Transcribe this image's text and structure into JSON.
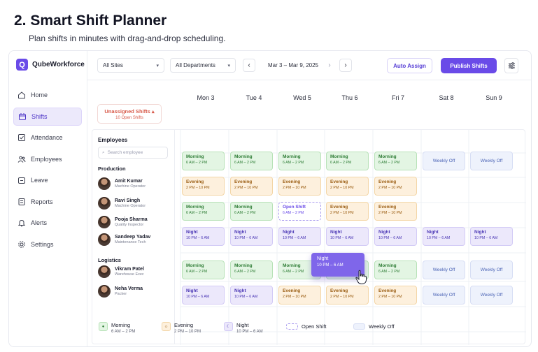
{
  "header": {
    "title": "2. Smart Shift Planner",
    "subtitle": "Plan shifts in minutes with drag-and-drop scheduling."
  },
  "app": {
    "brand": "QubeWorkforce",
    "nav": [
      {
        "label": "Home",
        "icon": "home-icon",
        "active": false
      },
      {
        "label": "Shifts",
        "icon": "calendar-icon",
        "active": true
      },
      {
        "label": "Attendance",
        "icon": "check-square-icon",
        "active": false
      },
      {
        "label": "Employees",
        "icon": "users-icon",
        "active": false
      },
      {
        "label": "Leave",
        "icon": "leave-icon",
        "active": false
      },
      {
        "label": "Reports",
        "icon": "report-icon",
        "active": false
      },
      {
        "label": "Alerts",
        "icon": "bell-icon",
        "active": false
      },
      {
        "label": "Settings",
        "icon": "gear-icon",
        "active": false
      }
    ]
  },
  "toolbar": {
    "site": "All Sites",
    "department": "All Departments",
    "date_range": "Mar 3 – Mar 9, 2025",
    "auto_assign": "Auto Assign",
    "publish": "Publish Shifts"
  },
  "days": [
    "Mon 3",
    "Tue 4",
    "Wed 5",
    "Thu 6",
    "Fri 7",
    "Sat 8",
    "Sun 9"
  ],
  "unassigned": {
    "label": "Unassigned Shifts",
    "count": "10 Open Shifts"
  },
  "employees_panel": {
    "title": "Employees",
    "search_placeholder": "Search employee",
    "groups": [
      {
        "name": "Production",
        "employees": [
          {
            "name": "Amit Kumar",
            "role": "Machine Operator"
          },
          {
            "name": "Ravi Singh",
            "role": "Machine Operator"
          },
          {
            "name": "Pooja Sharma",
            "role": "Quality Inspector"
          },
          {
            "name": "Sandeep Yadav",
            "role": "Maintenance Tech"
          }
        ]
      },
      {
        "name": "Logistics",
        "employees": [
          {
            "name": "Vikram Patel",
            "role": "Warehouse Exec"
          },
          {
            "name": "Neha Verma",
            "role": "Packer"
          }
        ]
      }
    ]
  },
  "shift_types": {
    "morning": {
      "label": "Morning",
      "time": "6 AM – 2 PM"
    },
    "evening": {
      "label": "Evening",
      "time": "2 PM – 10 PM"
    },
    "night": {
      "label": "Night",
      "time": "10 PM – 6 AM"
    },
    "off": {
      "label": "Weekly Off",
      "time": ""
    },
    "open": {
      "label": "Open Shift",
      "time": "6 AM – 2 PM"
    }
  },
  "schedule": [
    [
      "morning",
      "morning",
      "morning",
      "morning",
      "morning",
      "off",
      "off"
    ],
    [
      "evening",
      "evening",
      "evening",
      "evening",
      "evening",
      "",
      ""
    ],
    [
      "morning",
      "morning",
      "open",
      "evening",
      "evening",
      "",
      ""
    ],
    [
      "night",
      "night",
      "night",
      "night",
      "night",
      "night",
      "night"
    ],
    [
      "morning",
      "morning",
      "morning",
      "morning",
      "morning",
      "off",
      "off"
    ],
    [
      "night",
      "night",
      "evening",
      "evening",
      "evening",
      "off",
      "off"
    ]
  ],
  "dragging": {
    "label": "Night",
    "time": "10 PM – 6 AM"
  },
  "legend": [
    {
      "type": "morning",
      "label": "Morning",
      "time": "6 AM – 2 PM"
    },
    {
      "type": "evening",
      "label": "Evening",
      "time": "2 PM – 10 PM"
    },
    {
      "type": "night",
      "label": "Night",
      "time": "10 PM – 6 AM"
    },
    {
      "type": "open",
      "label": "Open Shift",
      "time": ""
    },
    {
      "type": "off",
      "label": "Weekly Off",
      "time": ""
    }
  ],
  "colors": {
    "accent": "#6a4be8",
    "morning": "#2f7d36",
    "evening": "#9a5d12",
    "night": "#4b37b5",
    "off": "#4a63b5",
    "unassigned": "#d85b4b"
  }
}
